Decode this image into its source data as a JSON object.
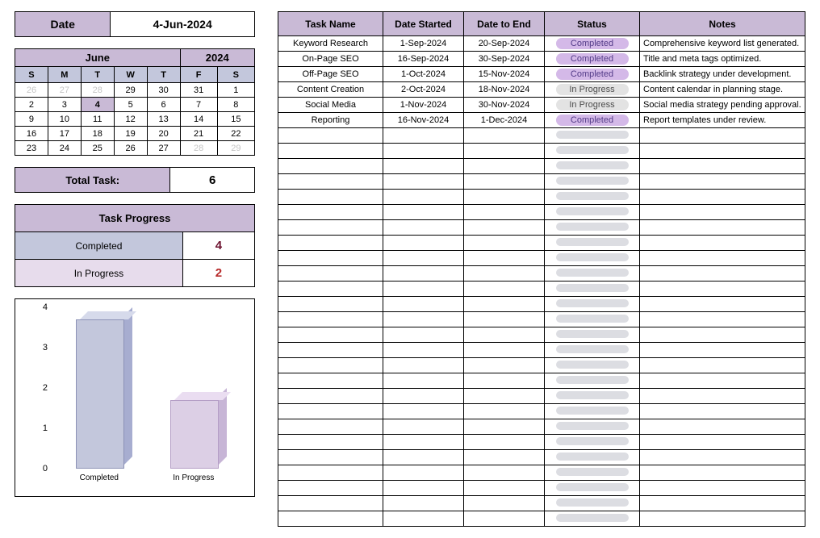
{
  "dateBox": {
    "label": "Date",
    "value": "4-Jun-2024"
  },
  "calendar": {
    "month": "June",
    "year": "2024",
    "dow": [
      "S",
      "M",
      "T",
      "W",
      "T",
      "F",
      "S"
    ],
    "cells": [
      [
        {
          "v": "26",
          "f": true
        },
        {
          "v": "27",
          "f": true
        },
        {
          "v": "28",
          "f": true
        },
        {
          "v": "29"
        },
        {
          "v": "30"
        },
        {
          "v": "31"
        },
        {
          "v": "1"
        }
      ],
      [
        {
          "v": "2"
        },
        {
          "v": "3"
        },
        {
          "v": "4",
          "today": true
        },
        {
          "v": "5"
        },
        {
          "v": "6"
        },
        {
          "v": "7"
        },
        {
          "v": "8"
        }
      ],
      [
        {
          "v": "9"
        },
        {
          "v": "10"
        },
        {
          "v": "11"
        },
        {
          "v": "12"
        },
        {
          "v": "13"
        },
        {
          "v": "14"
        },
        {
          "v": "15"
        }
      ],
      [
        {
          "v": "16"
        },
        {
          "v": "17"
        },
        {
          "v": "18"
        },
        {
          "v": "19"
        },
        {
          "v": "20"
        },
        {
          "v": "21"
        },
        {
          "v": "22"
        }
      ],
      [
        {
          "v": "23"
        },
        {
          "v": "24"
        },
        {
          "v": "25"
        },
        {
          "v": "26"
        },
        {
          "v": "27"
        },
        {
          "v": "28",
          "f": true
        },
        {
          "v": "29",
          "f": true
        }
      ]
    ]
  },
  "totalTask": {
    "label": "Total Task:",
    "value": "6"
  },
  "progress": {
    "header": "Task Progress",
    "rows": [
      {
        "label": "Completed",
        "value": "4",
        "kind": "completed"
      },
      {
        "label": "In Progress",
        "value": "2",
        "kind": "inprogress"
      }
    ]
  },
  "chart_data": {
    "type": "bar",
    "categories": [
      "Completed",
      "In Progress"
    ],
    "values": [
      3.7,
      1.7
    ],
    "ylim": [
      0,
      4
    ],
    "yticks": [
      0,
      1,
      2,
      3,
      4
    ],
    "xlabel": "",
    "ylabel": "",
    "title": ""
  },
  "taskTable": {
    "headers": [
      "Task Name",
      "Date Started",
      "Date to End",
      "Status",
      "Notes"
    ],
    "rows": [
      {
        "name": "Keyword Research",
        "start": "1-Sep-2024",
        "end": "20-Sep-2024",
        "status": "Completed",
        "notes": "Comprehensive keyword list generated."
      },
      {
        "name": "On-Page SEO",
        "start": "16-Sep-2024",
        "end": "30-Sep-2024",
        "status": "Completed",
        "notes": "Title and meta tags optimized."
      },
      {
        "name": "Off-Page SEO",
        "start": "1-Oct-2024",
        "end": "15-Nov-2024",
        "status": "Completed",
        "notes": "Backlink strategy under development."
      },
      {
        "name": "Content Creation",
        "start": "2-Oct-2024",
        "end": "18-Nov-2024",
        "status": "In Progress",
        "notes": "Content calendar in planning stage."
      },
      {
        "name": "Social Media",
        "start": "1-Nov-2024",
        "end": "30-Nov-2024",
        "status": "In Progress",
        "notes": "Social media strategy pending approval."
      },
      {
        "name": "Reporting",
        "start": "16-Nov-2024",
        "end": "1-Dec-2024",
        "status": "Completed",
        "notes": "Report templates under review."
      }
    ],
    "emptyRows": 26
  }
}
